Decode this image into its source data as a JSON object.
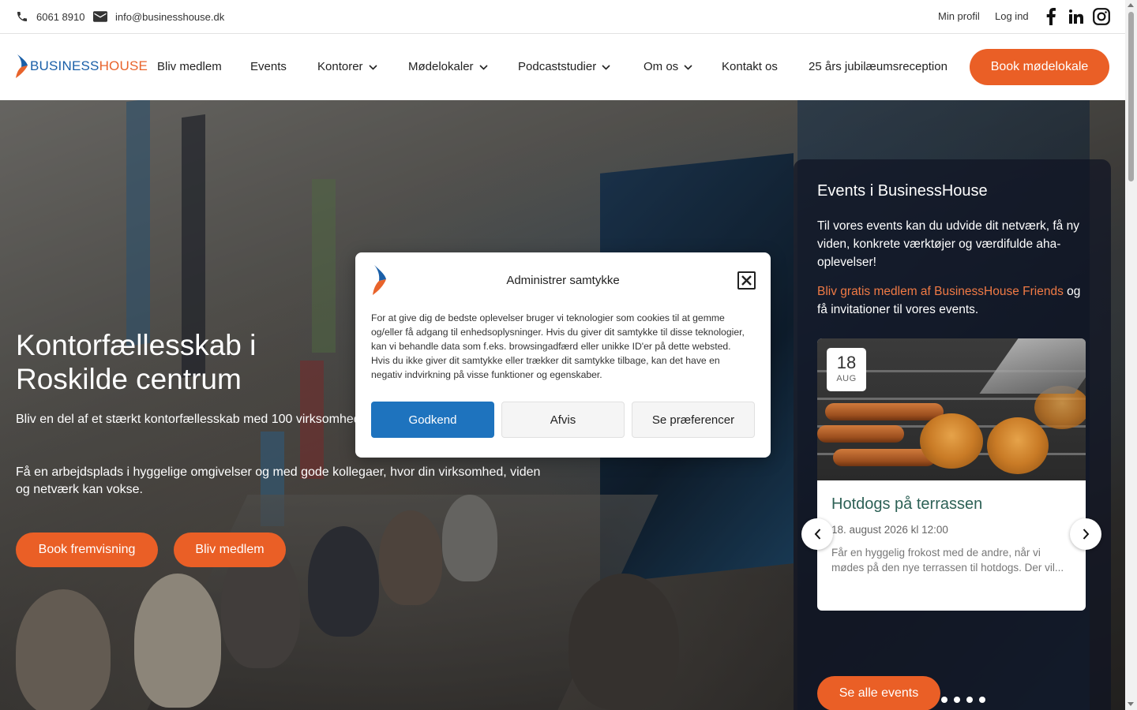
{
  "topbar": {
    "phone": "6061 8910",
    "email": "info@businesshouse.dk",
    "my_profile": "Min profil",
    "login": "Log ind",
    "social_icons": [
      "facebook-icon",
      "linkedin-icon",
      "instagram-icon"
    ]
  },
  "header": {
    "logo_business": "BUSINESS",
    "logo_house": "HOUSE",
    "nav": [
      {
        "label": "Bliv medlem",
        "dropdown": false
      },
      {
        "label": "Events",
        "dropdown": false
      },
      {
        "label": "Kontorer",
        "dropdown": true
      },
      {
        "label": "Mødelokaler",
        "dropdown": true
      },
      {
        "label": "Podcaststudier",
        "dropdown": true
      },
      {
        "label": "Om os",
        "dropdown": true
      },
      {
        "label": "Kontakt os",
        "dropdown": false
      },
      {
        "label": "25 års jubilæumsreception",
        "dropdown": false
      }
    ],
    "cta": "Book mødelokale"
  },
  "hero": {
    "title": "Kontorfællesskab i Roskilde centrum",
    "paragraph1": "Bliv en del af et stærkt kontorfællesskab med 100 virksomheder fra forskellige brancher.",
    "paragraph2": "Få en arbejdsplads i hyggelige omgivelser og med gode kollegaer, hvor din virksomhed, viden og netværk kan vokse.",
    "btn_showing": "Book fremvisning",
    "btn_member": "Bliv medlem"
  },
  "events": {
    "title": "Events i BusinessHouse",
    "intro": "Til vores events kan du udvide dit netværk, få ny viden, konkrete værktøjer og værdifulde aha-oplevelser!",
    "promo_link": "Bliv gratis medlem af  BusinessHouse Friends",
    "promo_rest": " og få invitationer til vores events.",
    "card": {
      "day": "18",
      "month": "AUG",
      "title": "Hotdogs på terrassen",
      "date": "18. august 2026 kl 12:00",
      "description": "Får en hyggelig frokost med de andre, når vi mødes på den nye terrassen til hotdogs. Der vil..."
    },
    "slide_count": 5,
    "active_slide": 1,
    "see_all": "Se alle events"
  },
  "cookie_modal": {
    "title": "Administrer samtykke",
    "text": "For at give dig de bedste oplevelser bruger vi teknologier som cookies til at gemme og/eller få adgang til enhedsoplysninger. Hvis du giver dit samtykke til disse teknologier, kan vi behandle data som f.eks. browsingadfærd eller unikke ID'er på dette websted. Hvis du ikke giver dit samtykke eller trækker dit samtykke tilbage, kan det have en negativ indvirkning på visse funktioner og egenskaber.",
    "accept": "Godkend",
    "reject": "Afvis",
    "preferences": "Se præferencer"
  },
  "colors": {
    "accent": "#ea5f26",
    "brand_blue": "#1a5fa8",
    "accept_blue": "#1e73be",
    "event_title": "#2d6156"
  }
}
